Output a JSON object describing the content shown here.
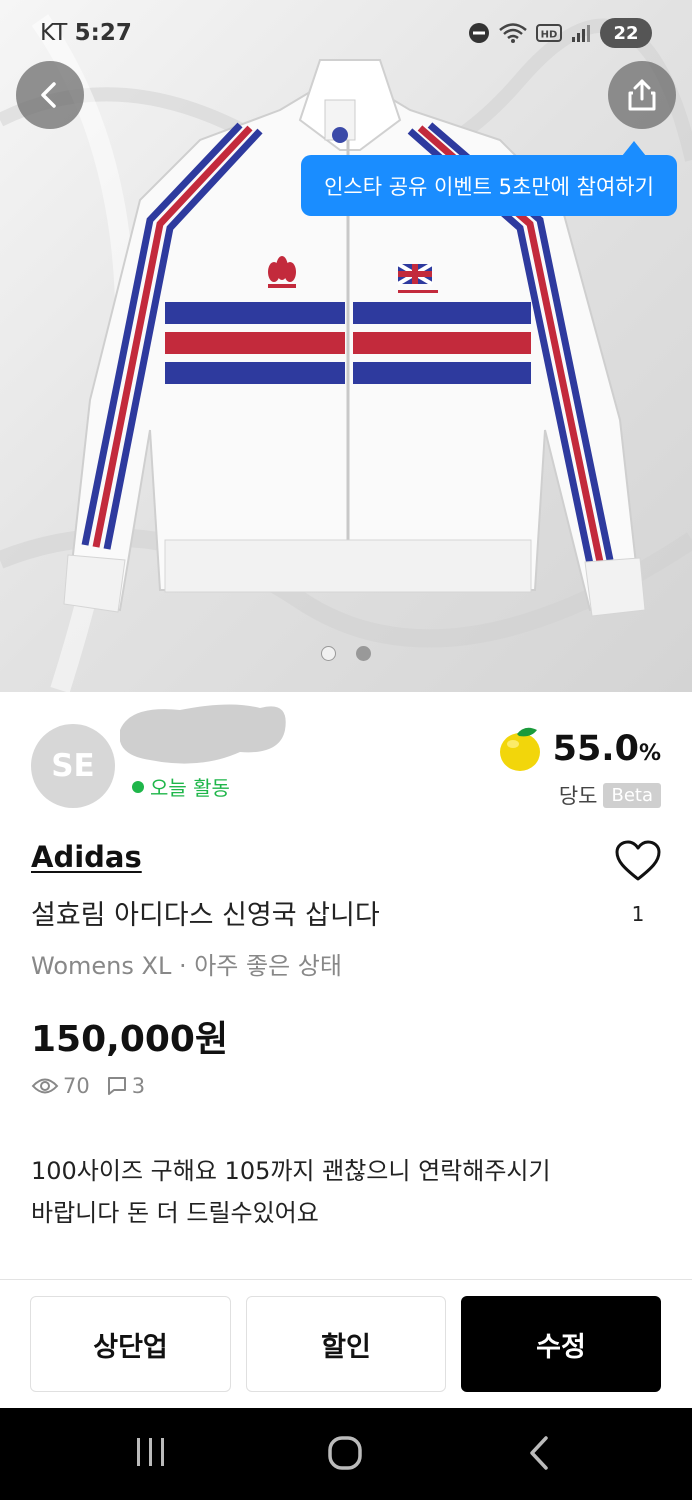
{
  "status_bar": {
    "carrier": "KT",
    "time": "5:27",
    "battery": "22",
    "icons": [
      "do-not-disturb-icon",
      "wifi-icon",
      "hd-icon",
      "signal-icon"
    ]
  },
  "header": {
    "back_icon": "back-arrow-icon",
    "share_icon": "share-icon",
    "tooltip": "인스타 공유 이벤트 5초만에 참여하기"
  },
  "carousel": {
    "total": 2,
    "active_index": 1
  },
  "seller": {
    "avatar_initials": "SE",
    "status": "오늘 활동"
  },
  "sweetness": {
    "value": "55.0",
    "unit": "%",
    "label": "당도",
    "badge": "Beta"
  },
  "product": {
    "brand": "Adidas",
    "title": "설효림 아디다스 신영국 삽니다",
    "meta": "Womens XL · 아주 좋은 상태",
    "price": "150,000원",
    "views": "70",
    "comments": "3",
    "likes": "1",
    "description_line1": "100사이즈 구해요 105까지 괜찮으니 연락해주시기",
    "description_line2": "바랍니다 돈 더 드릴수있어요"
  },
  "actions": {
    "bump": "상단업",
    "discount": "할인",
    "edit": "수정"
  },
  "colors": {
    "accent_blue": "#1a8dff",
    "active_green": "#1fb64a",
    "primary_button": "#000000"
  }
}
